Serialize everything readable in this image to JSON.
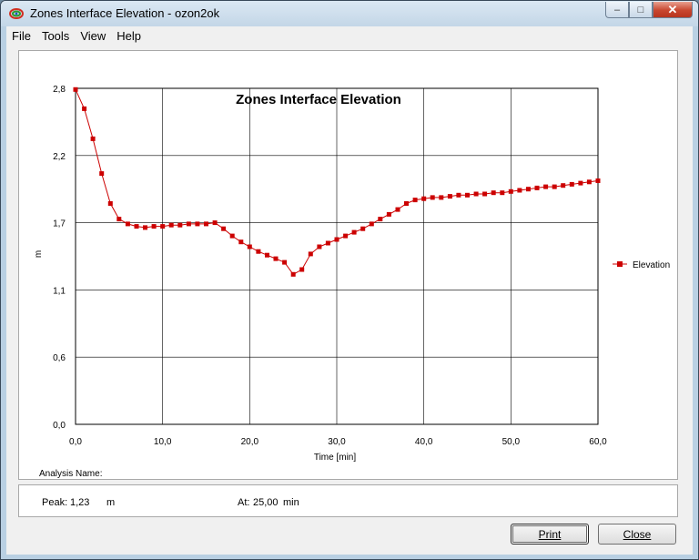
{
  "window": {
    "title": "Zones Interface Elevation - ozon2ok",
    "buttons": {
      "minimize": "–",
      "maximize": "□",
      "close": "✕"
    }
  },
  "menu": [
    "File",
    "Tools",
    "View",
    "Help"
  ],
  "chart_data": {
    "type": "line",
    "title": "Zones Interface Elevation",
    "xlabel": "Time [min]",
    "ylabel": "m",
    "xlim": [
      0,
      60
    ],
    "ylim": [
      0,
      2.8
    ],
    "x_ticks": [
      0,
      10,
      20,
      30,
      40,
      50,
      60
    ],
    "x_tick_labels": [
      "0,0",
      "10,0",
      "20,0",
      "30,0",
      "40,0",
      "50,0",
      "60,0"
    ],
    "y_ticks": [
      0,
      0.56,
      1.12,
      1.68,
      2.24,
      2.8
    ],
    "y_tick_labels": [
      "0,0",
      "0,6",
      "1,1",
      "1,7",
      "2,2",
      "2,8"
    ],
    "grid": true,
    "legend_position": "right",
    "series": [
      {
        "name": "Elevation",
        "color": "#cc0000",
        "x": [
          0,
          1,
          2,
          3,
          4,
          5,
          6,
          7,
          8,
          9,
          10,
          11,
          12,
          13,
          14,
          15,
          16,
          17,
          18,
          19,
          20,
          21,
          22,
          23,
          24,
          25,
          26,
          27,
          28,
          29,
          30,
          31,
          32,
          33,
          34,
          35,
          36,
          37,
          38,
          39,
          40,
          41,
          42,
          43,
          44,
          45,
          46,
          47,
          48,
          49,
          50,
          51,
          52,
          53,
          54,
          55,
          56,
          57,
          58,
          59,
          60
        ],
        "y": [
          2.79,
          2.63,
          2.38,
          2.09,
          1.84,
          1.71,
          1.67,
          1.65,
          1.64,
          1.65,
          1.65,
          1.66,
          1.66,
          1.67,
          1.67,
          1.67,
          1.68,
          1.63,
          1.57,
          1.52,
          1.48,
          1.44,
          1.41,
          1.38,
          1.35,
          1.25,
          1.29,
          1.42,
          1.48,
          1.51,
          1.54,
          1.57,
          1.6,
          1.63,
          1.67,
          1.71,
          1.75,
          1.79,
          1.84,
          1.87,
          1.88,
          1.89,
          1.89,
          1.9,
          1.91,
          1.91,
          1.92,
          1.92,
          1.93,
          1.93,
          1.94,
          1.95,
          1.96,
          1.97,
          1.98,
          1.98,
          1.99,
          2.0,
          2.01,
          2.02,
          2.03
        ]
      }
    ]
  },
  "analysis": {
    "label": "Analysis Name:",
    "value": ""
  },
  "peak": {
    "label": "Peak:",
    "value": "1,23",
    "unit": "m"
  },
  "at": {
    "label": "At:",
    "value": "25,00",
    "unit": "min"
  },
  "buttons": {
    "print": "Print",
    "close": "Close"
  }
}
